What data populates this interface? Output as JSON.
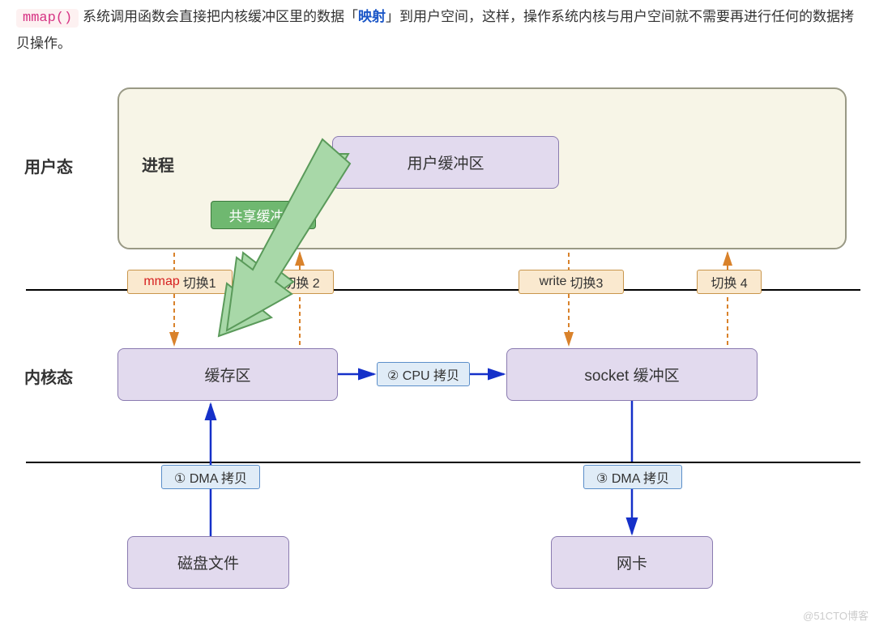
{
  "intro": {
    "code": "mmap()",
    "text1": "系统调用函数会直接把内核缓冲区里的数据「",
    "highlight": "映射",
    "text2": "」到用户空间，这样，操作系统内核与用户空间就不需要再进行任何的数据拷贝操作。"
  },
  "labels": {
    "user_mode": "用户态",
    "kernel_mode": "内核态",
    "process": "进程"
  },
  "boxes": {
    "user_buffer": "用户缓冲区",
    "shared_buffer": "共享缓冲区",
    "cache": "缓存区",
    "socket_buffer": "socket 缓冲区",
    "disk": "磁盘文件",
    "nic": "网卡"
  },
  "switches": {
    "mmap": "mmap",
    "sw1": "切换1",
    "sw2": "切换 2",
    "write": "write",
    "sw3": "切换3",
    "sw4": "切换 4"
  },
  "ops": {
    "dma1": "① DMA 拷贝",
    "cpu": "② CPU 拷贝",
    "dma3": "③ DMA 拷贝"
  },
  "watermark": "@51CTO博客"
}
